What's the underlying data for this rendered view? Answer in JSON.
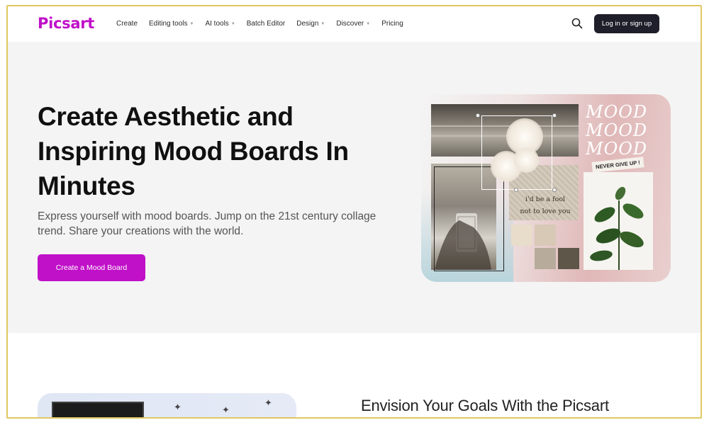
{
  "header": {
    "logo": "Picsart",
    "nav": [
      {
        "label": "Create",
        "dropdown": false
      },
      {
        "label": "Editing tools",
        "dropdown": true
      },
      {
        "label": "AI tools",
        "dropdown": true
      },
      {
        "label": "Batch Editor",
        "dropdown": false
      },
      {
        "label": "Design",
        "dropdown": true
      },
      {
        "label": "Discover",
        "dropdown": true
      },
      {
        "label": "Pricing",
        "dropdown": false
      }
    ],
    "search_icon": "search-icon",
    "login_label": "Log in or sign up"
  },
  "hero": {
    "title": "Create Aesthetic and Inspiring Mood Boards In Minutes",
    "subtitle": "Express yourself with mood boards. Jump on the 21st century collage trend. Share your creations with the world.",
    "cta_label": "Create a Mood Board"
  },
  "collage": {
    "mood_text": "MOOD MOOD MOOD",
    "tag_text": "NEVER GIVE UP !",
    "quote_line1": "i'd be a fool",
    "quote_line2": "not to love you"
  },
  "lower": {
    "title": "Envision Your Goals With the Picsart"
  },
  "colors": {
    "brand": "#c010c8",
    "login_bg": "#1f1f2b",
    "hero_bg": "#f4f4f4"
  }
}
